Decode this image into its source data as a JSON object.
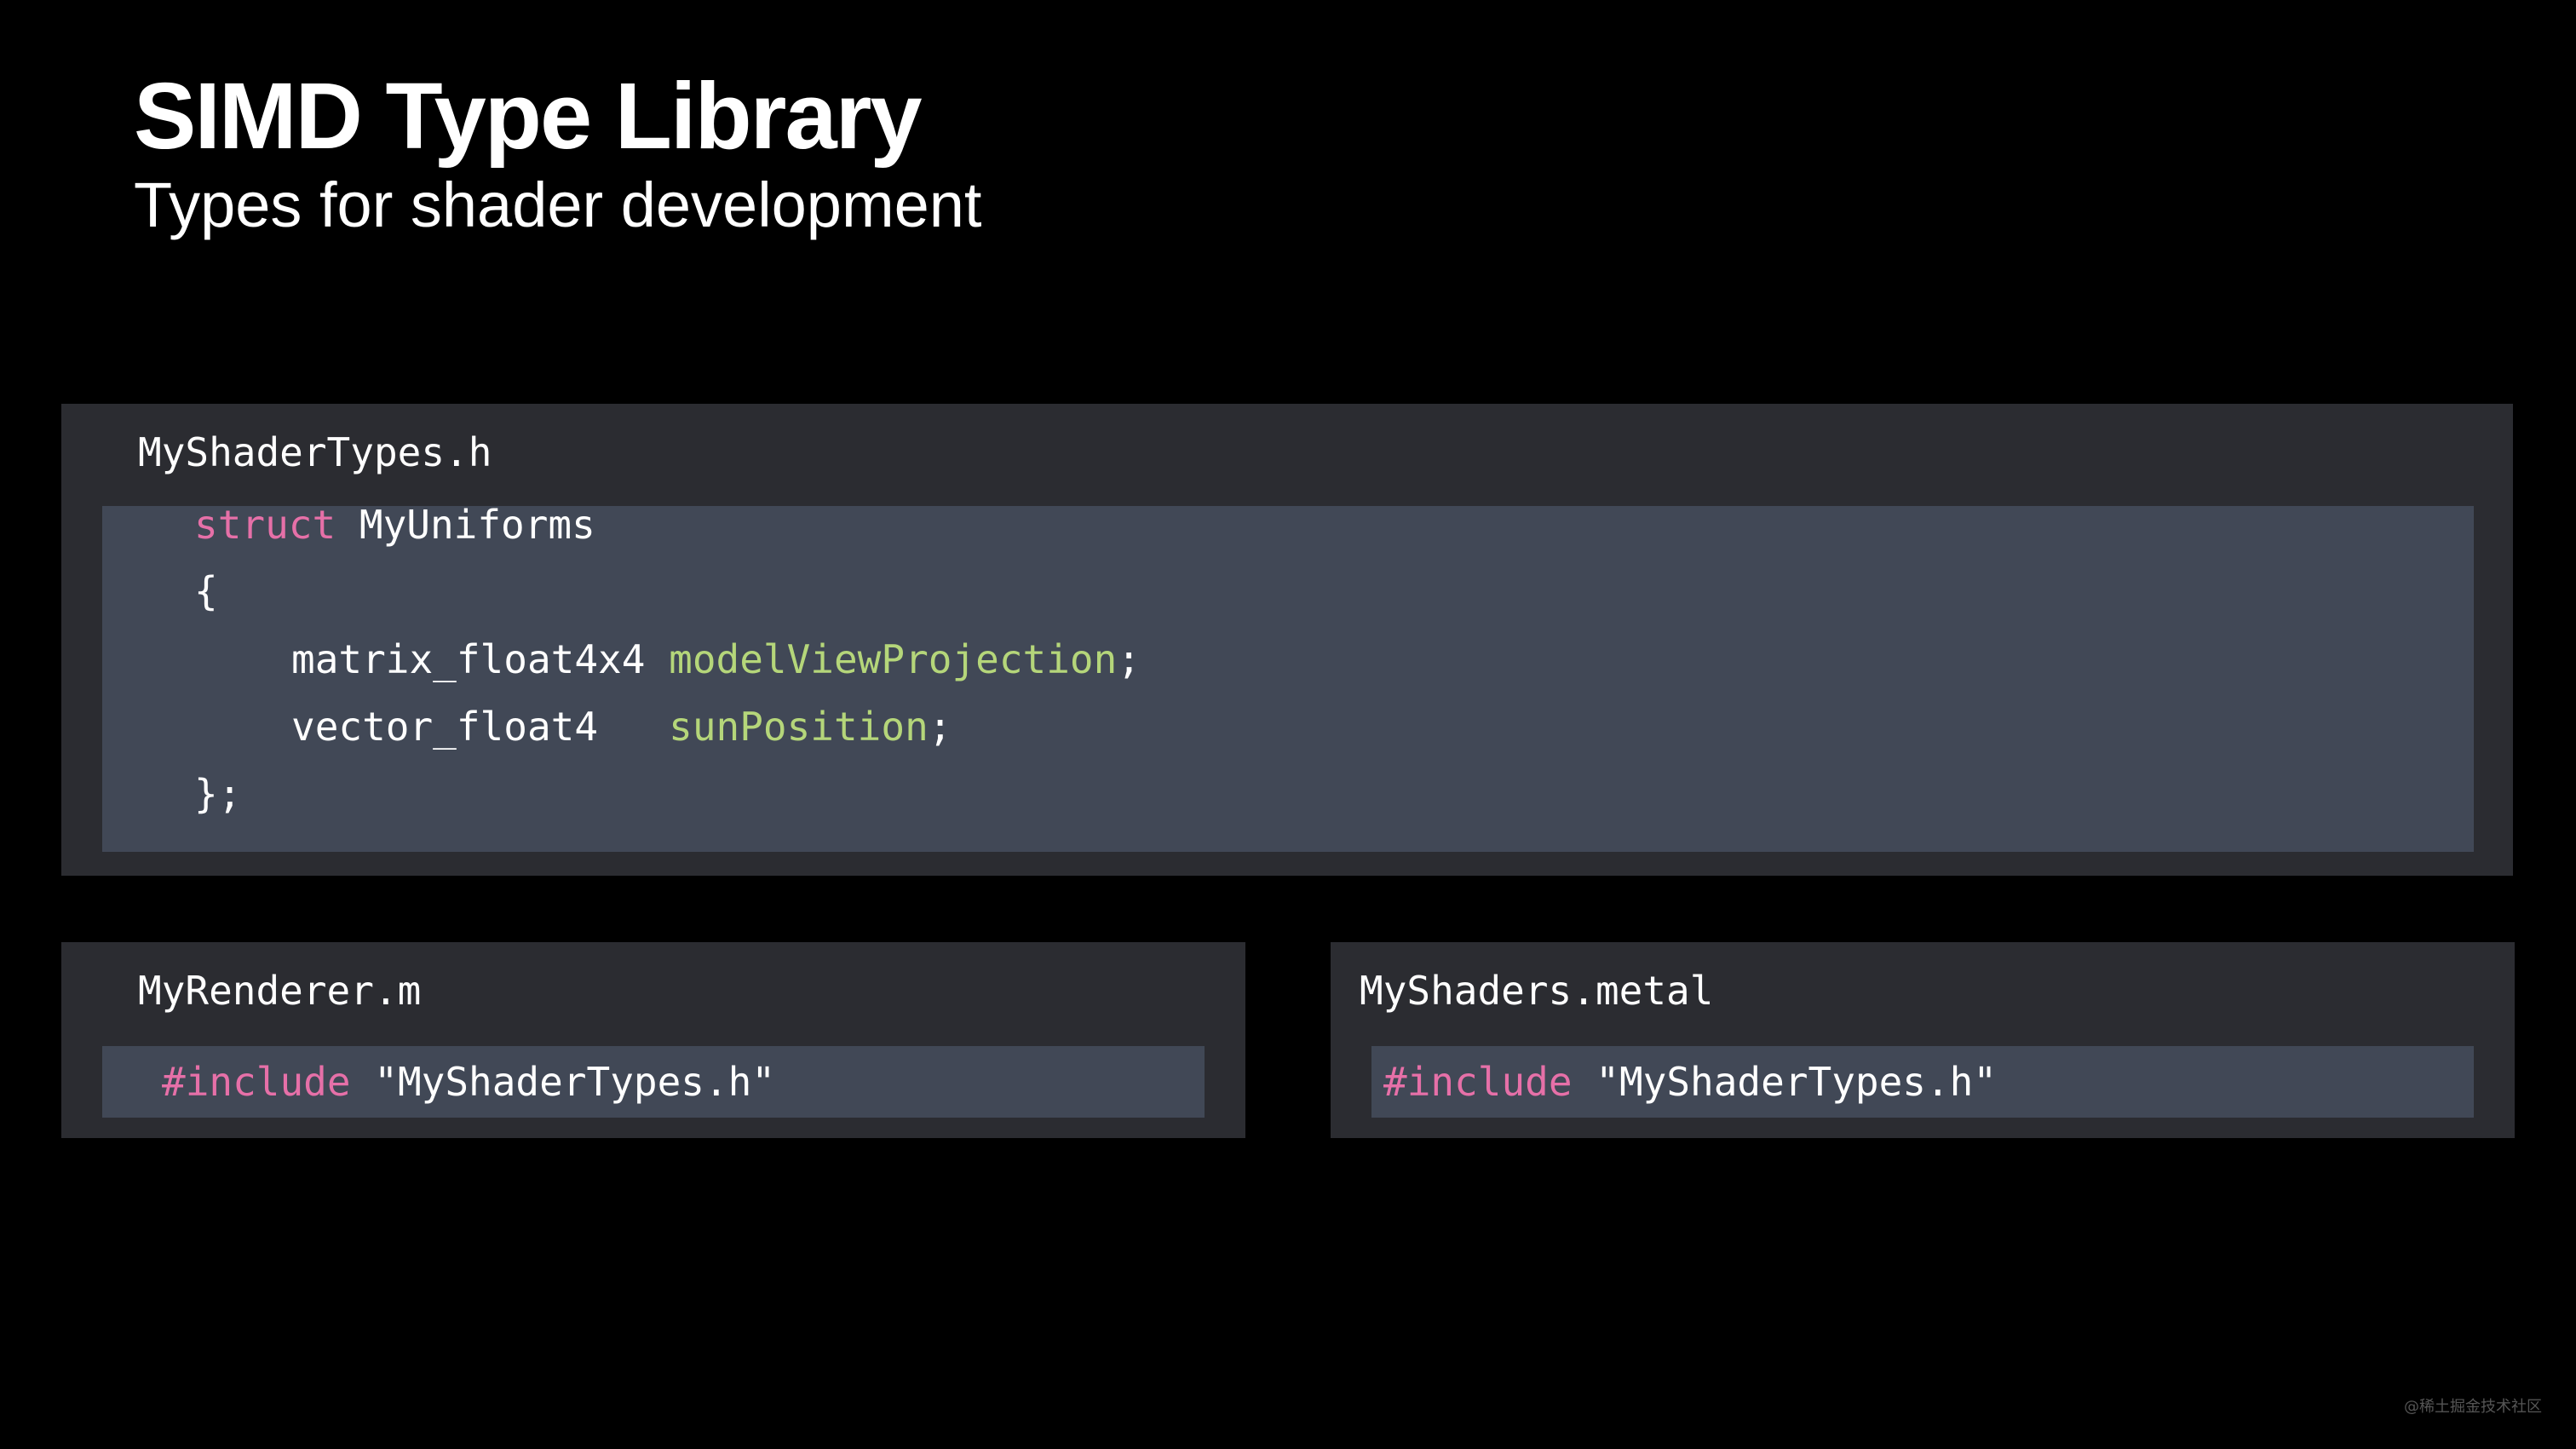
{
  "slide": {
    "title": "SIMD Type Library",
    "subtitle": "Types for shader development",
    "watermark": "@稀土掘金技术社区"
  },
  "panels": {
    "types": {
      "filename": "MyShaderTypes.h",
      "lines": {
        "l1": {
          "kw": "struct",
          "name": "MyUniforms"
        },
        "l2": {
          "text": "{"
        },
        "l3": {
          "type": "matrix_float4x4",
          "field": "modelViewProjection",
          "end": ";"
        },
        "l4": {
          "type": "vector_float4",
          "field": "sunPosition",
          "end": ";"
        },
        "l5": {
          "text": "};"
        }
      }
    },
    "renderer": {
      "filename": "MyRenderer.m",
      "include_kw": "#include",
      "include_file": "\"MyShaderTypes.h\""
    },
    "shaders": {
      "filename": "MyShaders.metal",
      "include_kw": "#include",
      "include_file": "\"MyShaderTypes.h\""
    }
  },
  "colors": {
    "background": "#000000",
    "panel": "#2b2c31",
    "code_background": "#414856",
    "keyword": "#e670a8",
    "identifier": "#b5d67a",
    "text": "#ffffff"
  }
}
